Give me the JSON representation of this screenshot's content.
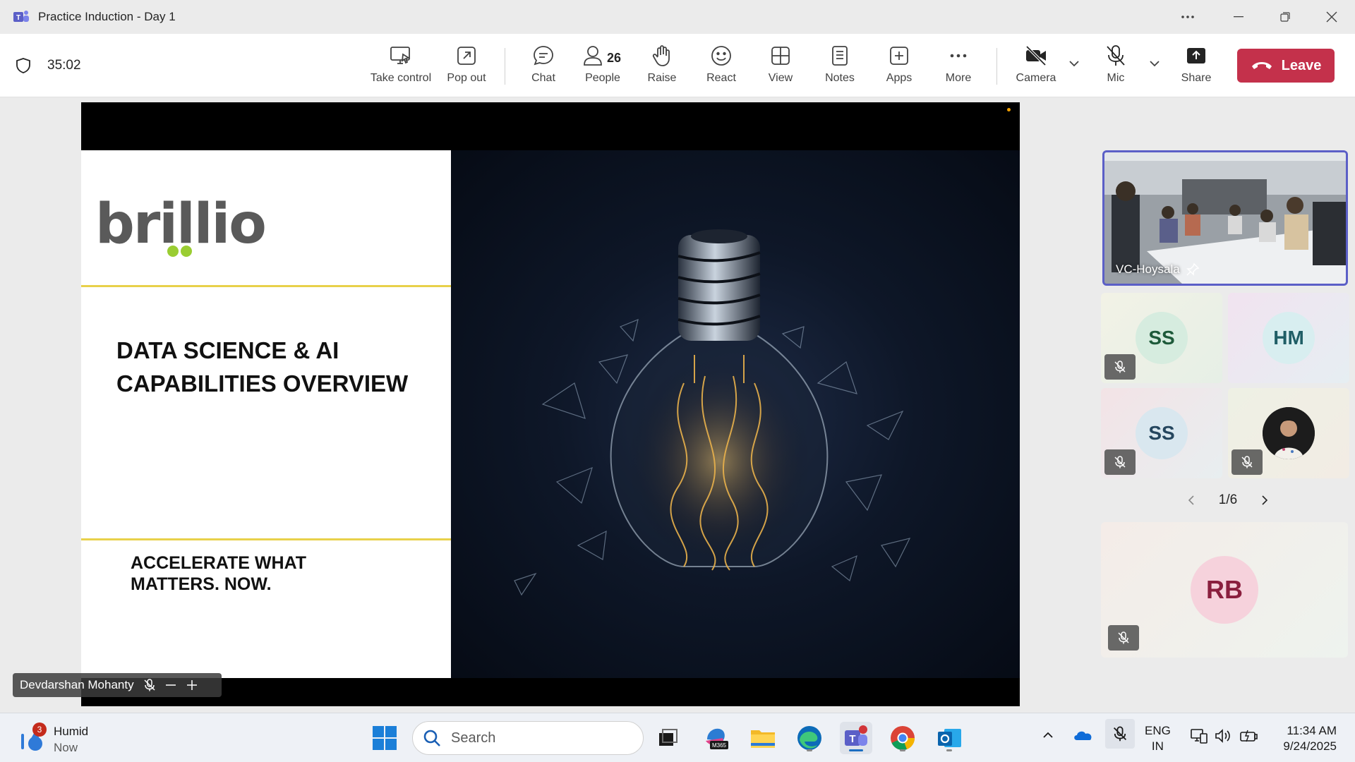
{
  "window": {
    "title": "Practice Induction - Day 1"
  },
  "meeting": {
    "timer": "35:02",
    "toolbar": {
      "take_control": "Take control",
      "pop_out": "Pop out",
      "chat": "Chat",
      "people": "People",
      "people_count": "26",
      "raise": "Raise",
      "react": "React",
      "view": "View",
      "notes": "Notes",
      "apps": "Apps",
      "more": "More",
      "camera": "Camera",
      "mic": "Mic",
      "share": "Share",
      "leave": "Leave"
    },
    "accent_color": "#5b5fc7",
    "leave_color": "#c4314b"
  },
  "stage": {
    "presenter_name": "Devdarshan Mohanty",
    "slide": {
      "brand": "brillio",
      "title_line1": "DATA SCIENCE & AI",
      "title_line2": "CAPABILITIES OVERVIEW",
      "tagline_line1": "ACCELERATE WHAT",
      "tagline_line2": "MATTERS. NOW."
    }
  },
  "participants": {
    "pinned": {
      "name": "VC-Hoysala"
    },
    "tiles": [
      {
        "initials": "SS",
        "avatar_bg": "#d6ecdf",
        "avatar_fg": "#1e5a3a",
        "muted": true
      },
      {
        "initials": "HM",
        "avatar_bg": "#d8eef0",
        "avatar_fg": "#1f5e66",
        "muted": false
      },
      {
        "initials": "SS",
        "avatar_bg": "#d9e7ef",
        "avatar_fg": "#25465e",
        "muted": true
      },
      {
        "initials": "",
        "avatar_bg": "#222222",
        "avatar_fg": "#ffffff",
        "muted": true,
        "photo": true
      },
      {
        "initials": "RB",
        "avatar_bg": "#f6d2dc",
        "avatar_fg": "#8a1f3e",
        "muted": true
      }
    ],
    "pager": "1/6"
  },
  "taskbar": {
    "weather_label": "Humid",
    "weather_sub": "Now",
    "notification_count": "3",
    "search_placeholder": "Search",
    "m365_label": "M365",
    "lang_line1": "ENG",
    "lang_line2": "IN",
    "time": "11:34 AM",
    "date": "9/24/2025"
  }
}
